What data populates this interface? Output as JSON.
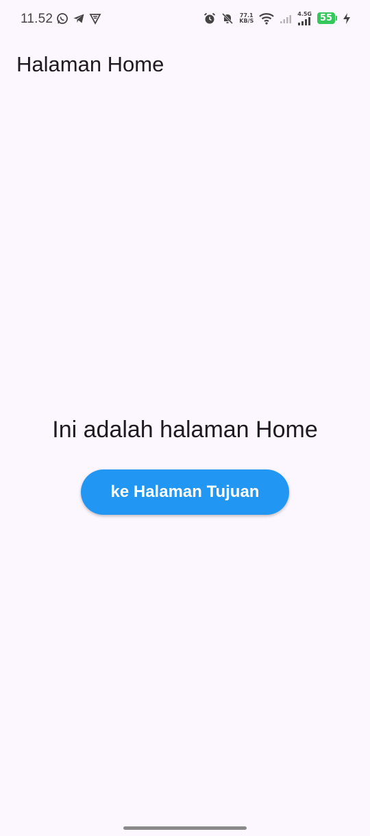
{
  "status_bar": {
    "time": "11.52",
    "left_icons": [
      "whatsapp-icon",
      "telegram-icon",
      "vpn-shield-icon"
    ],
    "net_speed_value": "77.1",
    "net_speed_unit": "KB/S",
    "network_type": "4.5G",
    "battery_level": "55",
    "battery_color": "#34c759",
    "right_icons": [
      "alarm-icon",
      "bell-off-icon",
      "net-speed",
      "wifi-icon",
      "signal-weak-icon",
      "cell-4g-signal-icon",
      "battery-icon",
      "charging-bolt-icon"
    ]
  },
  "app_bar": {
    "title": "Halaman Home"
  },
  "main": {
    "message": "Ini adalah halaman Home",
    "button_label": "ke Halaman Tujuan",
    "button_color": "#2196f3"
  },
  "colors": {
    "background": "#fcf6fe",
    "text": "#1d1b20"
  }
}
